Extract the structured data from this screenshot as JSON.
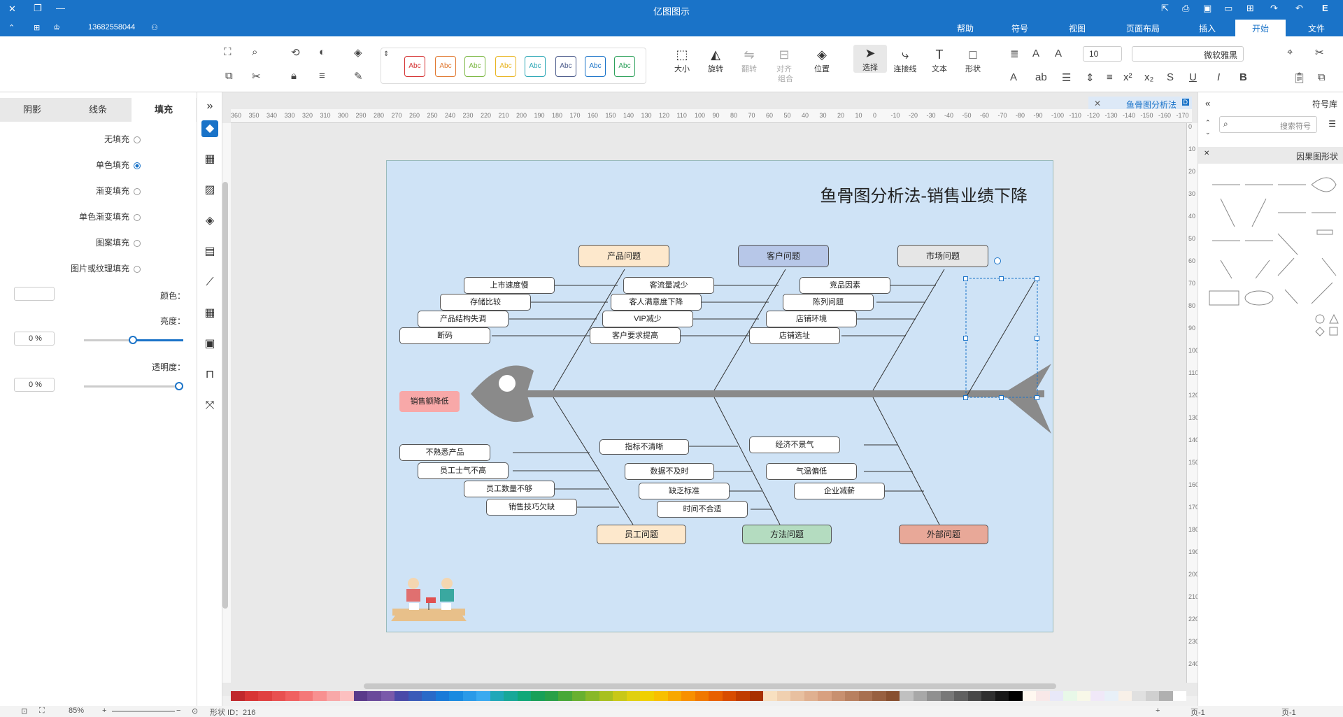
{
  "window": {
    "title": "亿图图示"
  },
  "topbar": {
    "phone": "13682558044",
    "menu_tabs": [
      "文件",
      "开始",
      "插入",
      "页面布局",
      "视图",
      "符号",
      "帮助"
    ]
  },
  "ribbon": {
    "font_name": "微软雅黑",
    "font_size": "10",
    "buttons": {
      "select": "选择",
      "connector": "连接线",
      "text": "文本",
      "shape": "形状",
      "position": "位置",
      "group": "组合",
      "align": "对齐",
      "flip": "翻转",
      "rotate": "旋转",
      "size": "大小"
    },
    "style_label": "Abc",
    "style_colors": [
      "#2ca05a",
      "#1a73c8",
      "#4a5a8a",
      "#2aa6b5",
      "#e8b420",
      "#7ab640",
      "#e07830",
      "#d43030"
    ]
  },
  "left_panel": {
    "tabs": [
      "填充",
      "线条",
      "阴影"
    ],
    "fill_options": [
      "无填充",
      "单色填充",
      "渐变填充",
      "单色渐变填充",
      "图案填充",
      "图片或纹理填充"
    ],
    "color_label": "颜色：",
    "brightness_label": "亮度：",
    "brightness_value": "0 %",
    "transparency_label": "透明度：",
    "transparency_value": "0 %"
  },
  "doc_tab": {
    "title": "鱼骨图分析法"
  },
  "diagram": {
    "title": "鱼骨图分析法-销售业绩下降",
    "head_label": "销售额降低",
    "categories": [
      {
        "label": "市场问题",
        "color": "#e6e6e6"
      },
      {
        "label": "客户问题",
        "color": "#b7c7e8"
      },
      {
        "label": "产品问题",
        "color": "#fde8cc"
      },
      {
        "label": "外部问题",
        "color": "#e8a898"
      },
      {
        "label": "方法问题",
        "color": "#b4dcc0"
      },
      {
        "label": "员工问题",
        "color": "#fde8cc"
      }
    ],
    "causes": {
      "market": [
        "竞品因素",
        "陈列问题",
        "店铺环境",
        "店铺选址"
      ],
      "customer": [
        "客流量减少",
        "客人满意度下降",
        "VIP减少",
        "客户要求提高"
      ],
      "product": [
        "上市速度慢",
        "存储比较",
        "产品结构失调",
        "断码"
      ],
      "external": [
        "经济不景气",
        "气温偏低",
        "企业减薪"
      ],
      "method": [
        "指标不清晰",
        "数据不及时",
        "缺乏标准",
        "时间不合适"
      ],
      "staff": [
        "不熟悉产品",
        "员工士气不高",
        "员工数量不够",
        "销售技巧欠缺"
      ]
    }
  },
  "right_panel": {
    "title": "符号库",
    "search_placeholder": "搜索符号",
    "category": "因果图形状"
  },
  "status": {
    "shape_id": "形状 ID：216",
    "zoom": "85%",
    "page": "页-1"
  }
}
